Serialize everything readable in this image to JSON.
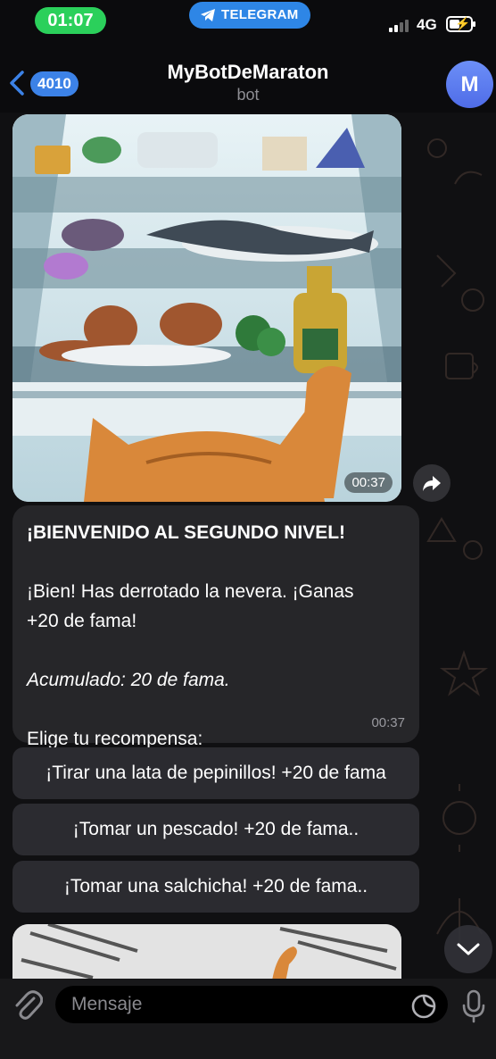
{
  "status_bar": {
    "time": "01:07",
    "app_pill": "TELEGRAM",
    "network": "4G"
  },
  "header": {
    "back_count": "4010",
    "title": "MyBotDeMaraton",
    "subtitle": "bot",
    "avatar_letter": "M"
  },
  "messages": {
    "image_time": "00:37",
    "text": {
      "heading": "¡BIENVENIDO AL SEGUNDO NIVEL!",
      "line1": "¡Bien! Has derrotado la nevera. ¡Ganas",
      "line2": "+20 de fama!",
      "accumulated": "Acumulado: 20 de fama.",
      "prompt": "Elige tu recompensa:",
      "time": "00:37"
    }
  },
  "keyboard": {
    "buttons": [
      "¡Tirar una lata de pepinillos! +20 de fama",
      "¡Tomar un pescado! +20 de fama..",
      "¡Tomar una salchicha! +20 de fama.."
    ]
  },
  "input": {
    "placeholder": "Mensaje"
  },
  "icons": {
    "back": "chevron-left-icon",
    "share": "share-arrow-icon",
    "scroll_down": "chevron-down-icon",
    "attach": "paperclip-icon",
    "sticker": "sticker-icon",
    "mic": "microphone-icon"
  },
  "colors": {
    "accent": "#3c82e7",
    "time_pill": "#2bd05b",
    "bubble": "#262629"
  }
}
